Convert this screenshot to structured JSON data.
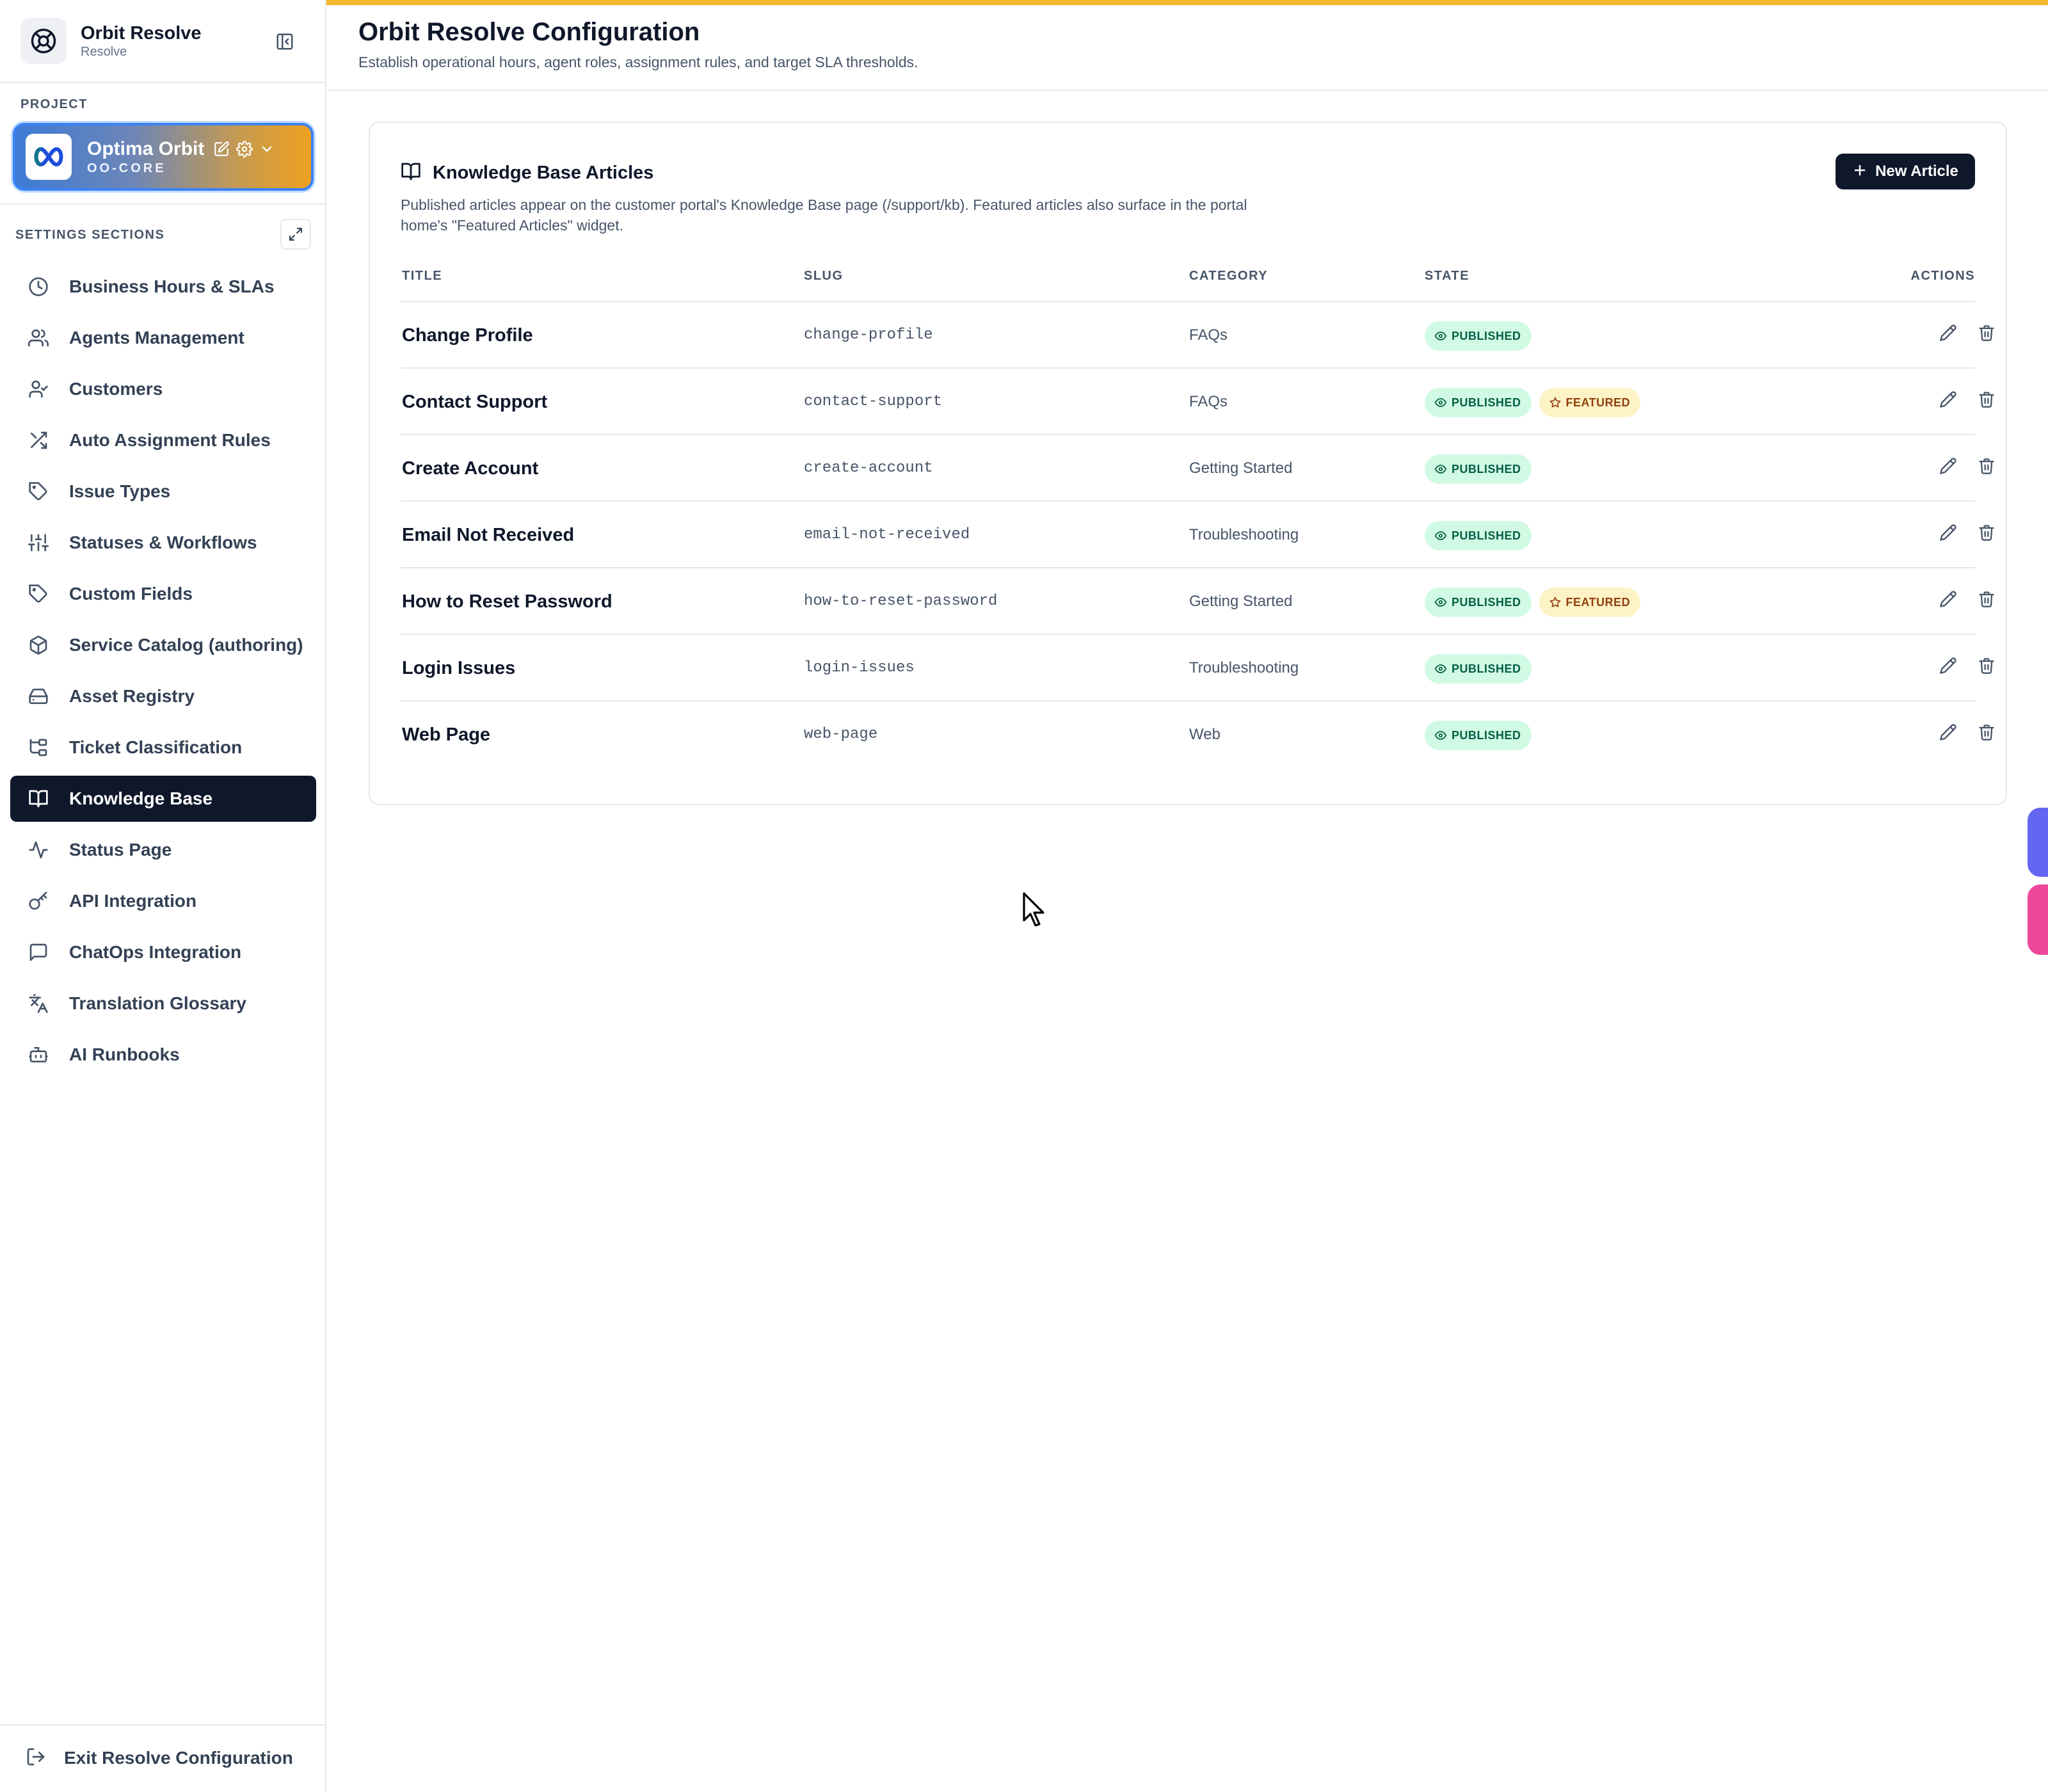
{
  "app": {
    "name": "Orbit Resolve",
    "subtitle": "Resolve",
    "accent": "#f5b82e"
  },
  "sidebar": {
    "project_label": "PROJECT",
    "project": {
      "name": "Optima Orbit",
      "code": "OO-CORE"
    },
    "sections_label": "SETTINGS SECTIONS",
    "items": [
      {
        "label": "Business Hours & SLAs",
        "icon": "clock-icon"
      },
      {
        "label": "Agents Management",
        "icon": "users-icon"
      },
      {
        "label": "Customers",
        "icon": "user-check-icon"
      },
      {
        "label": "Auto Assignment Rules",
        "icon": "shuffle-icon"
      },
      {
        "label": "Issue Types",
        "icon": "tag-icon"
      },
      {
        "label": "Statuses & Workflows",
        "icon": "sliders-icon"
      },
      {
        "label": "Custom Fields",
        "icon": "tag-icon"
      },
      {
        "label": "Service Catalog (authoring)",
        "icon": "package-icon"
      },
      {
        "label": "Asset Registry",
        "icon": "hard-drive-icon"
      },
      {
        "label": "Ticket Classification",
        "icon": "folder-tree-icon"
      },
      {
        "label": "Knowledge Base",
        "icon": "book-open-icon",
        "active": true
      },
      {
        "label": "Status Page",
        "icon": "activity-icon"
      },
      {
        "label": "API Integration",
        "icon": "key-icon"
      },
      {
        "label": "ChatOps Integration",
        "icon": "message-square-icon"
      },
      {
        "label": "Translation Glossary",
        "icon": "languages-icon"
      },
      {
        "label": "AI Runbooks",
        "icon": "bot-icon"
      }
    ],
    "exit_label": "Exit Resolve Configuration"
  },
  "header": {
    "title": "Orbit Resolve Configuration",
    "subtitle": "Establish operational hours, agent roles, assignment rules, and target SLA thresholds."
  },
  "kb": {
    "title": "Knowledge Base Articles",
    "description": "Published articles appear on the customer portal's Knowledge Base page (/support/kb). Featured articles also surface in the portal home's \"Featured Articles\" widget.",
    "new_button": "New Article",
    "columns": {
      "title": "TITLE",
      "slug": "SLUG",
      "category": "CATEGORY",
      "state": "STATE",
      "actions": "ACTIONS"
    },
    "badge_published": "PUBLISHED",
    "badge_featured": "FEATURED",
    "rows": [
      {
        "title": "Change Profile",
        "slug": "change-profile",
        "category": "FAQs",
        "published": true,
        "featured": false
      },
      {
        "title": "Contact Support",
        "slug": "contact-support",
        "category": "FAQs",
        "published": true,
        "featured": true
      },
      {
        "title": "Create Account",
        "slug": "create-account",
        "category": "Getting Started",
        "published": true,
        "featured": false
      },
      {
        "title": "Email Not Received",
        "slug": "email-not-received",
        "category": "Troubleshooting",
        "published": true,
        "featured": false
      },
      {
        "title": "How to Reset Password",
        "slug": "how-to-reset-password",
        "category": "Getting Started",
        "published": true,
        "featured": true
      },
      {
        "title": "Login Issues",
        "slug": "login-issues",
        "category": "Troubleshooting",
        "published": true,
        "featured": false
      },
      {
        "title": "Web Page",
        "slug": "web-page",
        "category": "Web",
        "published": true,
        "featured": false
      }
    ]
  }
}
